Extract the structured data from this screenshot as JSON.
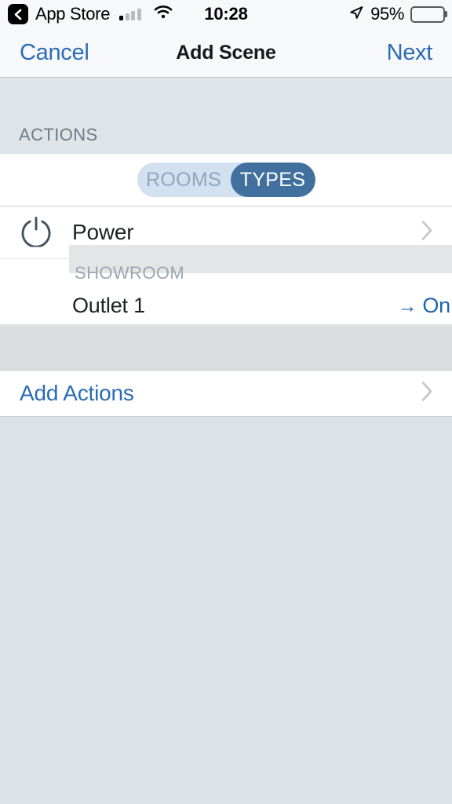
{
  "status_bar": {
    "back_icon": "chevron-left-icon",
    "carrier_app": "App Store",
    "signal_icon": "cellular-signal-icon",
    "signal_bars_filled": 1,
    "signal_bars_total": 4,
    "wifi_icon": "wifi-icon",
    "time": "10:28",
    "location_icon": "location-arrow-icon",
    "battery_percent": "95%",
    "battery_icon": "battery-icon",
    "battery_level": 95
  },
  "nav_bar": {
    "cancel_label": "Cancel",
    "title": "Add Scene",
    "next_label": "Next"
  },
  "section": {
    "header": "ACTIONS"
  },
  "segmented_control": {
    "options": [
      {
        "label": "ROOMS",
        "selected": false
      },
      {
        "label": "TYPES",
        "selected": true
      }
    ],
    "selected": "TYPES"
  },
  "list": {
    "type_row": {
      "icon": "power-icon",
      "label": "Power",
      "disclosure_icon": "chevron-right-icon"
    },
    "group_header": "SHOWROOM",
    "items": [
      {
        "label": "Outlet 1",
        "arrow": "→",
        "value": "On"
      }
    ]
  },
  "add_actions": {
    "label": "Add Actions",
    "disclosure_icon": "chevron-right-icon"
  },
  "colors": {
    "tint_blue": "#2b6cb5",
    "value_blue": "#1c63ad",
    "segment_selected": "#41709f",
    "segment_track": "#d2e0ef",
    "background": "#dfe4e8",
    "icon_slate": "#445260"
  }
}
